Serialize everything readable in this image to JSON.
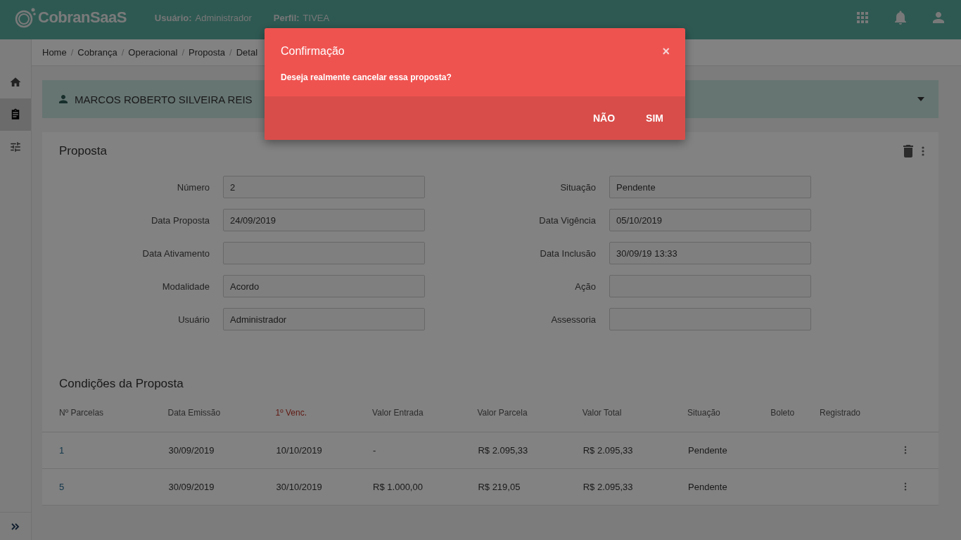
{
  "header": {
    "brand": "CobranSaaS",
    "user_label": "Usuário:",
    "user_value": "Administrador",
    "profile_label": "Perfil:",
    "profile_value": "TIVEA"
  },
  "sidebar": {
    "items": [
      {
        "kind": "home",
        "selected": false
      },
      {
        "kind": "clipboard",
        "selected": true
      },
      {
        "kind": "sliders",
        "selected": false
      }
    ]
  },
  "breadcrumb": {
    "separator": "/",
    "items": [
      "Home",
      "Cobrança",
      "Operacional",
      "Proposta",
      "Detal"
    ]
  },
  "client": {
    "name": "MARCOS ROBERTO SILVEIRA REIS"
  },
  "proposal": {
    "title": "Proposta",
    "fields": [
      {
        "label": "Número",
        "value": "2"
      },
      {
        "label": "Situação",
        "value": "Pendente"
      },
      {
        "label": "Data Proposta",
        "value": "24/09/2019"
      },
      {
        "label": "Data Vigência",
        "value": "05/10/2019"
      },
      {
        "label": "Data Ativamento"
      },
      {
        "label": "Data Inclusão",
        "value": "30/09/19 13:33"
      },
      {
        "label": "Modalidade",
        "value": "Acordo"
      },
      {
        "label": "Ação"
      },
      {
        "label": "Usuário",
        "value": "Administrador"
      },
      {
        "label": "Assessoria"
      }
    ]
  },
  "conditions": {
    "title": "Condições da Proposta",
    "columns": [
      {
        "label": "Nº Parcelas",
        "sorted": false
      },
      {
        "label": "Data Emissão",
        "sorted": false
      },
      {
        "label": "1º Venc.",
        "sorted": true
      },
      {
        "label": "Valor Entrada",
        "sorted": false
      },
      {
        "label": "Valor Parcela",
        "sorted": false
      },
      {
        "label": "Valor Total",
        "sorted": false
      },
      {
        "label": "Situação",
        "sorted": false
      },
      {
        "label": "Boleto",
        "sorted": false
      },
      {
        "label": "Registrado",
        "sorted": false
      }
    ],
    "rows": [
      [
        "1",
        "30/09/2019",
        "10/10/2019",
        "-",
        "R$ 2.095,33",
        "R$ 2.095,33",
        "Pendente"
      ],
      [
        "5",
        "30/09/2019",
        "30/10/2019",
        "R$ 1.000,00",
        "R$ 219,05",
        "R$ 2.095,33",
        "Pendente"
      ]
    ]
  },
  "dialog": {
    "title": "Confirmação",
    "close": "×",
    "message": "Deseja realmente cancelar essa proposta?",
    "buttons": [
      "NÃO",
      "SIM"
    ]
  }
}
